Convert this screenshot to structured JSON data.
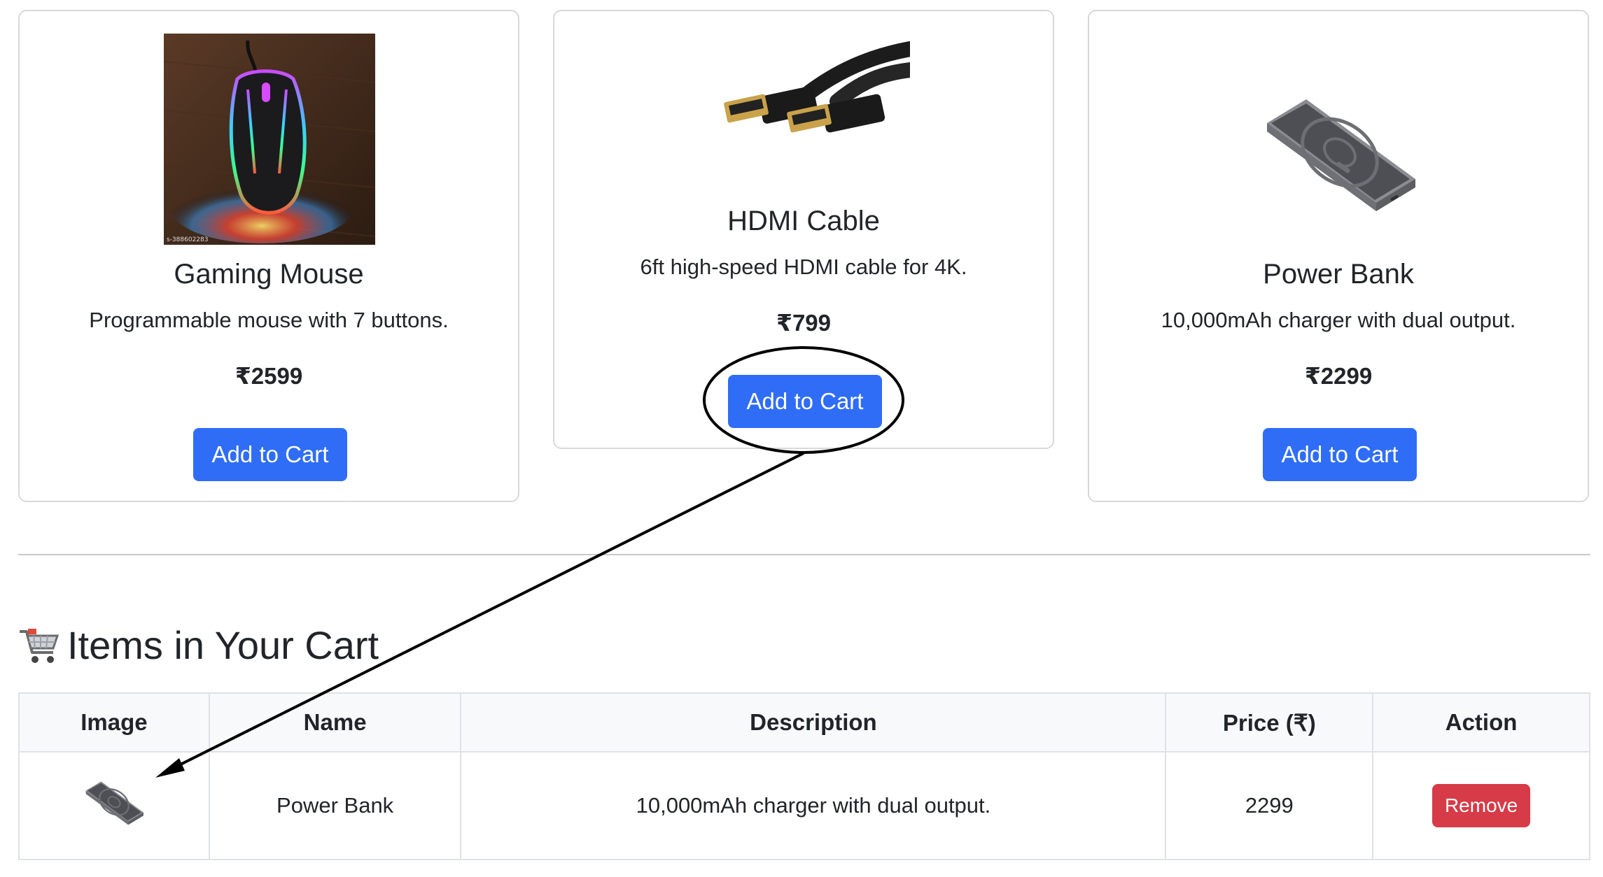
{
  "products": [
    {
      "title": "Gaming Mouse",
      "description": "Programmable mouse with 7 buttons.",
      "price": "₹2599",
      "button_label": "Add to Cart",
      "image_caption": "s-388602283",
      "image_icon": "gaming-mouse-image"
    },
    {
      "title": "HDMI Cable",
      "description": "6ft high-speed HDMI cable for 4K.",
      "price": "₹799",
      "button_label": "Add to Cart",
      "image_icon": "hdmi-cable-image"
    },
    {
      "title": "Power Bank",
      "description": "10,000mAh charger with dual output.",
      "price": "₹2299",
      "button_label": "Add to Cart",
      "image_icon": "power-bank-image"
    }
  ],
  "cart": {
    "heading": "Items in Your Cart",
    "heading_icon": "shopping-cart-icon",
    "columns": [
      "Image",
      "Name",
      "Description",
      "Price (₹)",
      "Action"
    ],
    "rows": [
      {
        "image_icon": "power-bank-thumbnail",
        "name": "Power Bank",
        "description": "10,000mAh charger with dual output.",
        "price": "2299",
        "action_label": "Remove"
      }
    ]
  },
  "colors": {
    "primary": "#2f6df6",
    "danger": "#d63b47",
    "border": "#d8d8d8",
    "table_header_bg": "#f8f9fa"
  }
}
